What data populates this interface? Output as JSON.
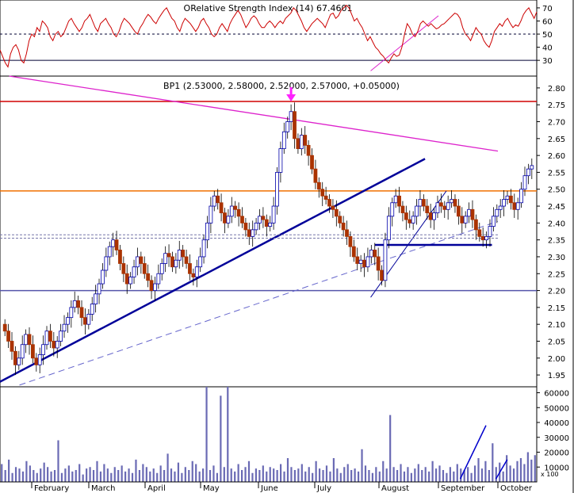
{
  "rsi_panel": {
    "title": "ORelative Strength Index (14) 67.4601",
    "yticks": [
      70,
      60,
      50,
      40,
      30
    ],
    "ylim": [
      18,
      76
    ],
    "hlines": [
      50,
      30
    ],
    "values": [
      38,
      33,
      28,
      25,
      35,
      40,
      42,
      38,
      30,
      28,
      35,
      45,
      50,
      48,
      55,
      52,
      60,
      58,
      55,
      48,
      45,
      50,
      52,
      48,
      50,
      55,
      60,
      62,
      58,
      55,
      52,
      55,
      60,
      62,
      65,
      60,
      55,
      52,
      58,
      60,
      62,
      58,
      55,
      50,
      48,
      52,
      58,
      62,
      60,
      58,
      55,
      52,
      50,
      55,
      58,
      62,
      65,
      63,
      60,
      58,
      62,
      65,
      68,
      70,
      66,
      62,
      60,
      55,
      52,
      58,
      62,
      60,
      58,
      55,
      52,
      55,
      60,
      62,
      58,
      55,
      50,
      48,
      50,
      55,
      58,
      55,
      52,
      58,
      62,
      65,
      68,
      65,
      60,
      55,
      58,
      62,
      64,
      62,
      58,
      55,
      55,
      58,
      60,
      58,
      55,
      58,
      60,
      58,
      62,
      64,
      66,
      70,
      68,
      64,
      60,
      55,
      52,
      55,
      58,
      60,
      62,
      60,
      58,
      55,
      60,
      65,
      66,
      62,
      64,
      68,
      70,
      72,
      70,
      65,
      60,
      62,
      58,
      55,
      50,
      45,
      48,
      44,
      40,
      38,
      35,
      33,
      30,
      28,
      32,
      35,
      33,
      34,
      40,
      50,
      58,
      55,
      50,
      48,
      52,
      58,
      60,
      58,
      56,
      58,
      56,
      54,
      55,
      57,
      58,
      60,
      62,
      64,
      66,
      65,
      62,
      55,
      50,
      48,
      45,
      50,
      55,
      52,
      50,
      45,
      42,
      40,
      45,
      52,
      55,
      58,
      56,
      60,
      62,
      58,
      55,
      57,
      56,
      60,
      65,
      68,
      70,
      66,
      62,
      67
    ]
  },
  "price_panel": {
    "title": "BP1 (2.53000, 2.58000, 2.52000, 2.57000, +0.05000)",
    "yticks": [
      "2.80",
      "2.75",
      "2.70",
      "2.65",
      "2.60",
      "2.55",
      "2.50",
      "2.45",
      "2.40",
      "2.35",
      "2.30",
      "2.25",
      "2.20",
      "2.15",
      "2.10",
      "2.05",
      "2.00",
      "1.95"
    ],
    "ylim": [
      1.915,
      2.835
    ],
    "horizontal_lines": [
      {
        "value": 2.76,
        "color": "#d00000"
      },
      {
        "value": 2.495,
        "color": "#f07000"
      },
      {
        "value": 2.2,
        "color": "#5555aa"
      }
    ],
    "closes": [
      2.08,
      2.05,
      2.02,
      1.98,
      2.0,
      2.04,
      2.07,
      2.04,
      2.0,
      1.98,
      2.01,
      2.04,
      2.08,
      2.05,
      2.03,
      2.05,
      2.08,
      2.1,
      2.12,
      2.15,
      2.17,
      2.15,
      2.12,
      2.1,
      2.13,
      2.16,
      2.19,
      2.22,
      2.26,
      2.3,
      2.33,
      2.35,
      2.32,
      2.28,
      2.25,
      2.22,
      2.24,
      2.27,
      2.3,
      2.28,
      2.25,
      2.23,
      2.2,
      2.22,
      2.25,
      2.28,
      2.31,
      2.3,
      2.27,
      2.29,
      2.32,
      2.3,
      2.28,
      2.25,
      2.24,
      2.27,
      2.3,
      2.35,
      2.4,
      2.45,
      2.48,
      2.46,
      2.43,
      2.4,
      2.42,
      2.45,
      2.44,
      2.42,
      2.4,
      2.38,
      2.36,
      2.38,
      2.4,
      2.42,
      2.41,
      2.39,
      2.4,
      2.45,
      2.55,
      2.62,
      2.67,
      2.7,
      2.73,
      2.65,
      2.62,
      2.66,
      2.63,
      2.6,
      2.56,
      2.52,
      2.5,
      2.48,
      2.47,
      2.45,
      2.44,
      2.42,
      2.4,
      2.38,
      2.36,
      2.33,
      2.3,
      2.28,
      2.29,
      2.27,
      2.3,
      2.32,
      2.3,
      2.26,
      2.23,
      2.35,
      2.42,
      2.46,
      2.48,
      2.45,
      2.43,
      2.41,
      2.4,
      2.42,
      2.45,
      2.47,
      2.45,
      2.43,
      2.41,
      2.43,
      2.46,
      2.45,
      2.44,
      2.46,
      2.47,
      2.45,
      2.42,
      2.4,
      2.42,
      2.44,
      2.41,
      2.38,
      2.36,
      2.35,
      2.36,
      2.39,
      2.42,
      2.44,
      2.45,
      2.47,
      2.48,
      2.46,
      2.44,
      2.46,
      2.5,
      2.54,
      2.56,
      2.57
    ],
    "trendlines": [
      {
        "x": [
          "Jan",
          "Aug 25"
        ],
        "y": [
          1.93,
          2.59
        ],
        "color": "#000099",
        "width": 2.5,
        "dash": ""
      },
      {
        "x": [
          "Jan 20",
          "Oct"
        ],
        "y": [
          1.92,
          2.405
        ],
        "color": "#6666cc",
        "width": 1,
        "dash": "8,5"
      },
      {
        "x": [
          "Jan 10",
          "Oct"
        ],
        "y": [
          2.835,
          2.613
        ],
        "color": "#dd22cc",
        "width": 1.3,
        "dash": ""
      },
      {
        "x": [
          "Jul 28",
          "Sep 5"
        ],
        "y": [
          2.18,
          2.495
        ],
        "color": "#000099",
        "width": 1,
        "dash": ""
      },
      {
        "x": [
          "Jul 30",
          "Sep 28"
        ],
        "y": [
          2.335,
          2.335
        ],
        "color": "#000099",
        "width": 2.5,
        "dash": ""
      },
      {
        "x": [
          "Jan",
          "Oct"
        ],
        "y": [
          2.355,
          2.355
        ],
        "color": "#7777aa",
        "width": 1,
        "dash": "3,2"
      },
      {
        "x": [
          "Jan",
          "Oct"
        ],
        "y": [
          2.365,
          2.365
        ],
        "color": "#7777aa",
        "width": 1,
        "dash": "3,2"
      }
    ],
    "arrow_color": "#ff22ff"
  },
  "volume_panel": {
    "yticks": [
      "60000",
      "50000",
      "40000",
      "30000",
      "20000",
      "10000"
    ],
    "ylim": [
      0,
      64000
    ],
    "scale_note": "x 100",
    "values": [
      12000,
      8000,
      15000,
      6000,
      10000,
      9000,
      7000,
      14000,
      11000,
      8000,
      6000,
      9000,
      13000,
      10000,
      7000,
      8000,
      28000,
      6000,
      9000,
      11000,
      7000,
      8000,
      12000,
      5000,
      9000,
      10000,
      8000,
      14000,
      7000,
      12000,
      9000,
      6000,
      10000,
      8000,
      11000,
      7000,
      9000,
      6000,
      15000,
      8000,
      12000,
      10000,
      7000,
      9000,
      6000,
      11000,
      8000,
      19000,
      9000,
      7000,
      13000,
      6000,
      10000,
      8000,
      14000,
      12000,
      7000,
      9000,
      65000,
      8000,
      11000,
      6000,
      58000,
      10000,
      64000,
      9000,
      7000,
      12000,
      8000,
      10000,
      14000,
      6000,
      9000,
      8000,
      11000,
      7000,
      10000,
      9000,
      8000,
      12000,
      7000,
      16000,
      10000,
      8000,
      9000,
      12000,
      7000,
      10000,
      6000,
      14000,
      9000,
      8000,
      11000,
      7000,
      16000,
      9000,
      6000,
      10000,
      12000,
      8000,
      9000,
      7000,
      22000,
      11000,
      8000,
      6000,
      10000,
      7000,
      14000,
      9000,
      45000,
      10000,
      8000,
      12000,
      7000,
      10000,
      6000,
      9000,
      12000,
      8000,
      10000,
      7000,
      14000,
      9000,
      11000,
      8000,
      6000,
      10000,
      7000,
      12000,
      9000,
      8000,
      10000,
      6000,
      11000,
      16000,
      9000,
      14000,
      8000,
      26000,
      10000,
      13000,
      7000,
      18000,
      11000,
      9000,
      14000,
      16000,
      12000,
      20000,
      15000,
      18000
    ],
    "trendlines": [
      {
        "x": [
          "Sep 12",
          "Sep 25"
        ],
        "y": [
          2000,
          38000
        ]
      },
      {
        "x": [
          "Sep 30",
          "Oct 8"
        ],
        "y": [
          2000,
          15000
        ]
      }
    ]
  },
  "x_axis": {
    "months": [
      "February",
      "March",
      "April",
      "May",
      "June",
      "July",
      "August",
      "September",
      "October"
    ]
  },
  "colors": {
    "up": "#0000aa",
    "down": "#aa3300",
    "rsi_line": "#cc0000",
    "volume": "#6a6ab4",
    "grid": "#000000"
  }
}
